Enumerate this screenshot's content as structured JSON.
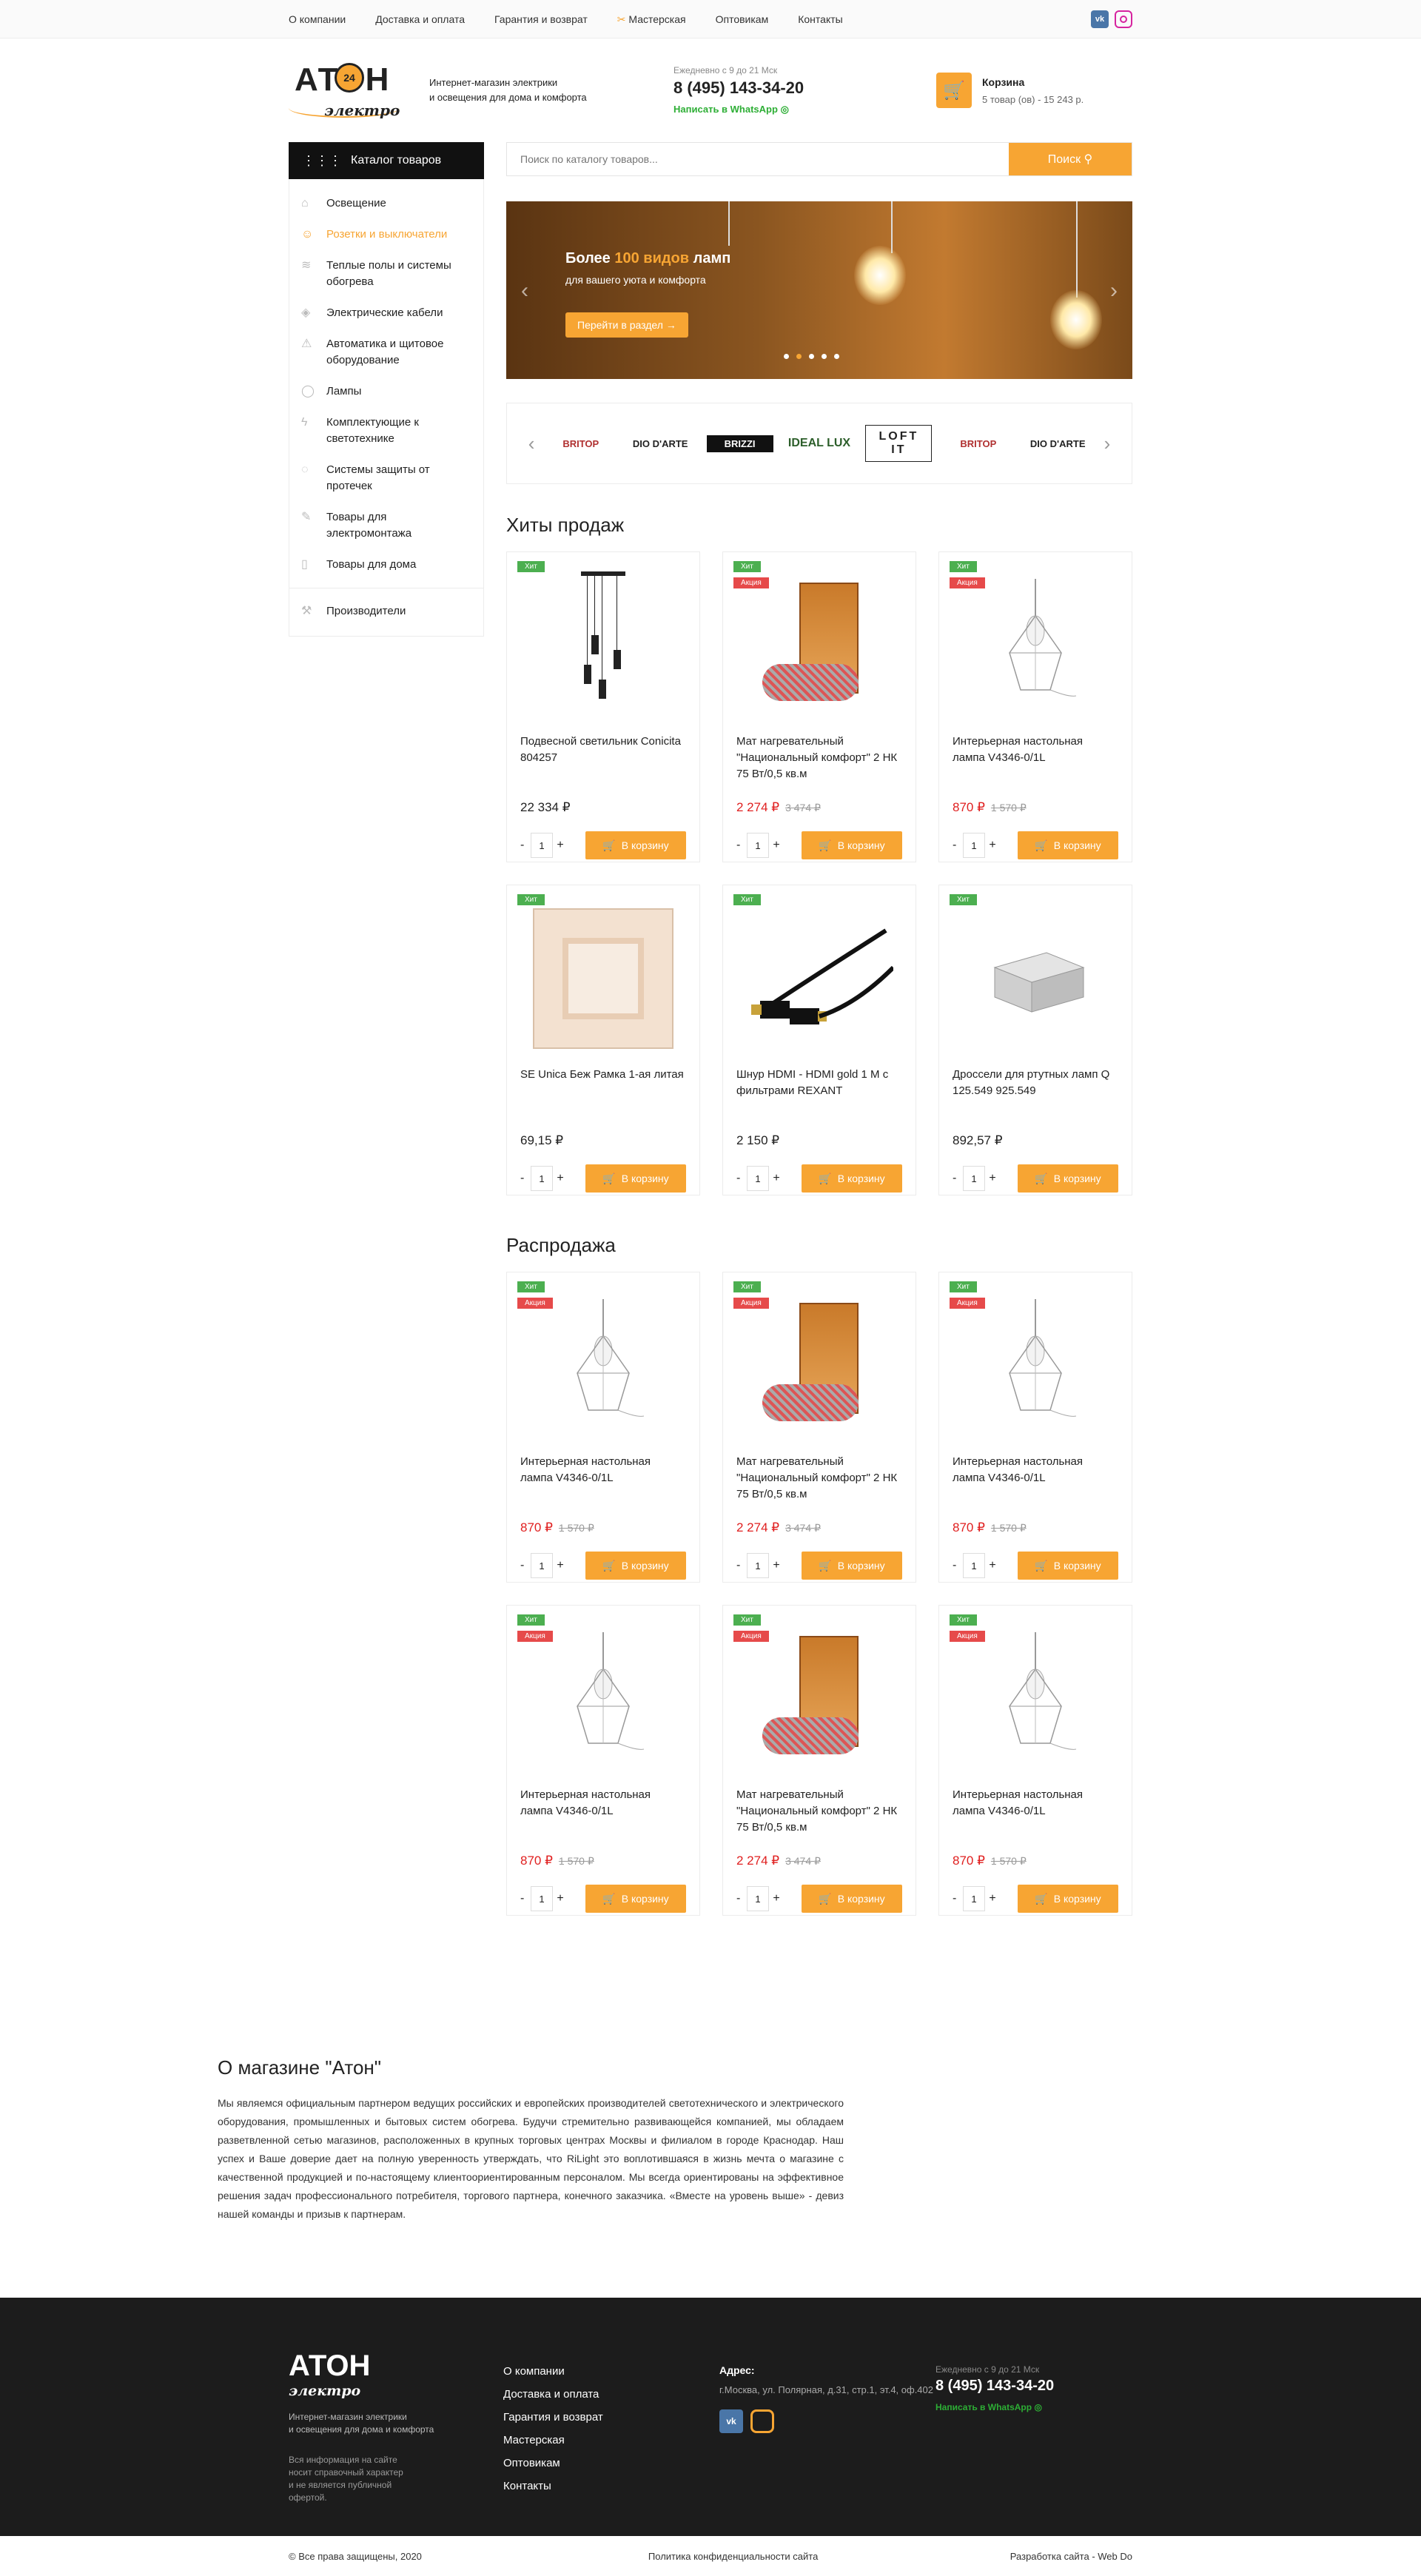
{
  "topnav": {
    "items": [
      "О компании",
      "Доставка и оплата",
      "Гарантия и возврат",
      "Мастерская",
      "Оптовикам",
      "Контакты"
    ],
    "vk": "vk"
  },
  "header": {
    "logo_main": "АТОН",
    "logo_num": "24",
    "logo_sub": "электро",
    "tagline1": "Интернет-магазин электрики",
    "tagline2": "и освещения для дома и комфорта",
    "hours": "Ежедневно с 9 до 21 Мск",
    "phone": "8 (495) 143-34-20",
    "whatsapp": "Написать в WhatsApp",
    "cart_label": "Корзина",
    "cart_summary": "5 товар (ов) - 15 243 р."
  },
  "catalog": {
    "button": "Каталог товаров",
    "items": [
      "Освещение",
      "Розетки и выключатели",
      "Теплые полы и системы обогрева",
      "Электрические кабели",
      "Автоматика и щитовое оборудование",
      "Лампы",
      "Комплектующие к светотехнике",
      "Системы защиты от протечек",
      "Товары для электромонтажа",
      "Товары для дома"
    ],
    "manufacturers": "Производители"
  },
  "search": {
    "placeholder": "Поиск по каталогу товаров...",
    "button": "Поиск"
  },
  "slider": {
    "title_pre": "Более ",
    "title_hl": "100 видов",
    "title_post": " ламп",
    "subtitle": "для вашего уюта и комфорта",
    "button": "Перейти в раздел →"
  },
  "brands": [
    "BRITOP",
    "DIO D'ARTE",
    "BRIZZI",
    "IDEAL LUX",
    "LOFT IT",
    "BRITOP",
    "DIO D'ARTE"
  ],
  "hits": {
    "title": "Хиты продаж",
    "products": [
      {
        "name": "Подвесной светильник Conicita 804257",
        "price": "22 334 ₽",
        "old": "",
        "badges": [
          "Хит"
        ],
        "img": "pendant"
      },
      {
        "name": "Мат нагревательный \"Национальный комфорт\" 2 НК 75 Вт/0,5 кв.м",
        "price": "2 274 ₽",
        "old": "3 474 ₽",
        "badges": [
          "Хит",
          "Акция"
        ],
        "img": "mat"
      },
      {
        "name": "Интерьерная настольная лампа V4346-0/1L",
        "price": "870 ₽",
        "old": "1 570 ₽",
        "badges": [
          "Хит",
          "Акция"
        ],
        "img": "lamp"
      },
      {
        "name": "SE Unica Беж Рамка 1-ая литая",
        "price": "69,15 ₽",
        "old": "",
        "badges": [
          "Хит"
        ],
        "img": "frame"
      },
      {
        "name": "Шнур HDMI - HDMI gold 1 М с фильтрами REXANT",
        "price": "2 150 ₽",
        "old": "",
        "badges": [
          "Хит"
        ],
        "img": "hdmi"
      },
      {
        "name": "Дроссели для ртутных ламп Q 125.549 925.549",
        "price": "892,57 ₽",
        "old": "",
        "badges": [
          "Хит"
        ],
        "img": "choke"
      }
    ]
  },
  "sale": {
    "title": "Распродажа",
    "products": [
      {
        "name": "Интерьерная настольная лампа V4346-0/1L",
        "price": "870 ₽",
        "old": "1 570 ₽",
        "badges": [
          "Хит",
          "Акция"
        ],
        "img": "lamp"
      },
      {
        "name": "Мат нагревательный \"Национальный комфорт\" 2 НК 75 Вт/0,5 кв.м",
        "price": "2 274 ₽",
        "old": "3 474 ₽",
        "badges": [
          "Хит",
          "Акция"
        ],
        "img": "mat"
      },
      {
        "name": "Интерьерная настольная лампа V4346-0/1L",
        "price": "870 ₽",
        "old": "1 570 ₽",
        "badges": [
          "Хит",
          "Акция"
        ],
        "img": "lamp"
      },
      {
        "name": "Интерьерная настольная лампа V4346-0/1L",
        "price": "870 ₽",
        "old": "1 570 ₽",
        "badges": [
          "Хит",
          "Акция"
        ],
        "img": "lamp"
      },
      {
        "name": "Мат нагревательный \"Национальный комфорт\" 2 НК 75 Вт/0,5 кв.м",
        "price": "2 274 ₽",
        "old": "3 474 ₽",
        "badges": [
          "Хит",
          "Акция"
        ],
        "img": "mat"
      },
      {
        "name": "Интерьерная настольная лампа V4346-0/1L",
        "price": "870 ₽",
        "old": "1 570 ₽",
        "badges": [
          "Хит",
          "Акция"
        ],
        "img": "lamp"
      }
    ]
  },
  "product_ui": {
    "qty": "1",
    "minus": "-",
    "plus": "+",
    "add": "В корзину"
  },
  "about": {
    "title": "О магазине \"Атон\"",
    "text": "Мы являемся официальным партнером ведущих российских и европейских производителей светотехнического и электрического оборудования, промышленных и бытовых систем обогрева. Будучи стремительно развивающейся компанией, мы обладаем разветвленной сетью магазинов, расположенных в крупных торговых центрах Москвы и филиалом в городе Краснодар. Наш успех и Ваше доверие дает на полную уверенность утверждать, что RiLight это воплотившаяся в жизнь мечта о магазине с качественной продукцией и по-настоящему клиентоориентированным персоналом. Мы всегда ориентированы на эффективное решения задач профессионального потребителя, торгового партнера, конечного заказчика. «Вместе на уровень выше» - девиз нашей команды и призыв к партнерам."
  },
  "footer": {
    "tagline1": "Интернет-магазин электрики",
    "tagline2": "и освещения для дома и комфорта",
    "disclaimer": "Вся информация на сайте носит справочный характер и не является публичной офертой.",
    "menu": [
      "О компании",
      "Доставка и оплата",
      "Гарантия и возврат",
      "Мастерская",
      "Оптовикам",
      "Контакты"
    ],
    "address_label": "Адрес:",
    "address": "г.Москва, ул. Полярная, д.31, стр.1, эт.4, оф.402",
    "hours": "Ежедневно с 9 до 21 Мск",
    "phone": "8 (495) 143-34-20",
    "whatsapp": "Написать в WhatsApp",
    "copyright": "© Все права защищены, 2020",
    "privacy": "Политика конфиденциальности сайта",
    "dev": "Разработка сайта - Web Do"
  },
  "colors": {
    "accent": "#f7a533",
    "hit": "#4caf50",
    "sale": "#e64a4a",
    "price_sale": "#e02020"
  }
}
